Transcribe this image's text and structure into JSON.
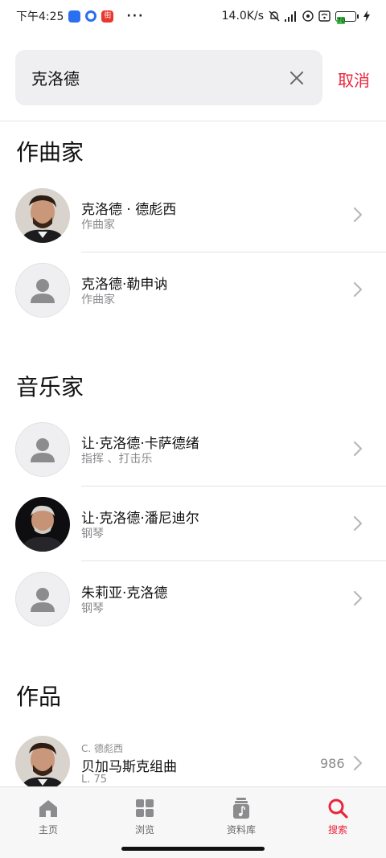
{
  "status_bar": {
    "time": "下午4:25",
    "more": "···",
    "network_speed": "14.0K/s",
    "battery": "70",
    "badge": "街"
  },
  "search": {
    "value": "克洛德",
    "cancel_label": "取消"
  },
  "sections": {
    "composers": {
      "title": "作曲家",
      "items": [
        {
          "name": "克洛德 · 德彪西",
          "role": "作曲家"
        },
        {
          "name": "克洛德·勒申讷",
          "role": "作曲家"
        }
      ]
    },
    "musicians": {
      "title": "音乐家",
      "items": [
        {
          "name": "让·克洛德·卡萨德绪",
          "role": "指挥 、打击乐"
        },
        {
          "name": "让·克洛德·潘尼迪尔",
          "role": "钢琴"
        },
        {
          "name": "朱莉亚·克洛德",
          "role": "钢琴"
        }
      ]
    },
    "works": {
      "title": "作品",
      "items": [
        {
          "composer": "C. 德彪西",
          "title": "贝加马斯克组曲",
          "catalog": "L. 75",
          "count": "986"
        }
      ]
    }
  },
  "tab_bar": {
    "tabs": [
      {
        "label": "主页",
        "icon": "home-icon"
      },
      {
        "label": "浏览",
        "icon": "grid-icon"
      },
      {
        "label": "资料库",
        "icon": "library-icon"
      },
      {
        "label": "搜索",
        "icon": "search-icon"
      }
    ],
    "active": "搜索"
  },
  "colors": {
    "accent": "#e8263c",
    "search_bg": "#efeff1",
    "secondary_text": "#8a8a8e"
  }
}
